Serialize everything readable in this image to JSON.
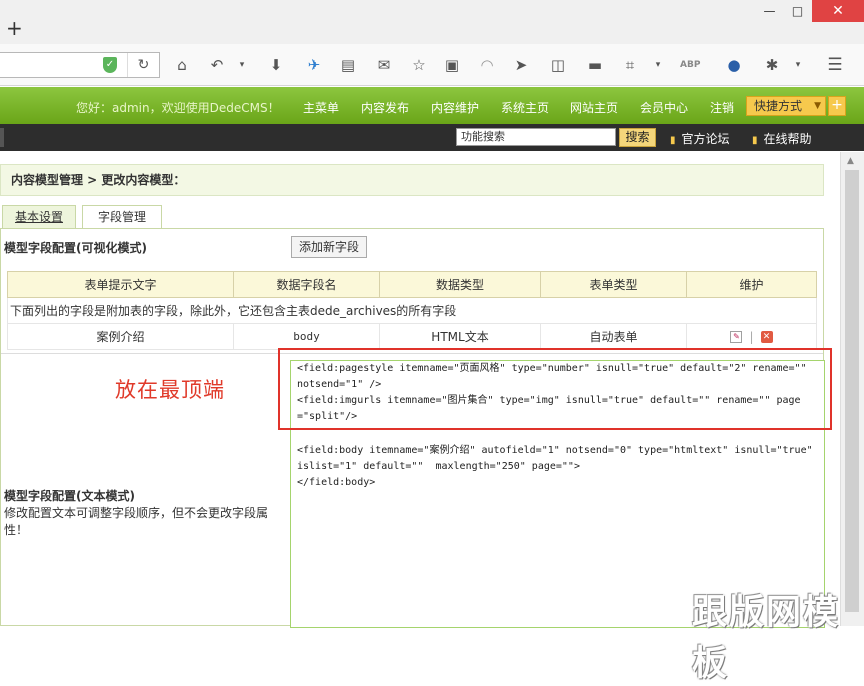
{
  "browser": {
    "new_tab": "+",
    "window_buttons": {
      "minimize": "—",
      "maximize": "□",
      "close": "✕"
    },
    "toolbar_icons": [
      "home-icon",
      "back-icon",
      "dropdown-icon",
      "download-icon",
      "bird-icon",
      "reader-icon",
      "mail-icon",
      "star-icon",
      "clipboard-icon",
      "rss-icon",
      "send-icon",
      "window-icon",
      "folder-icon",
      "crop-icon",
      "dropdown-icon",
      "abp-icon",
      "globe-icon",
      "bug-icon",
      "dropdown-icon",
      "hamburger-icon"
    ]
  },
  "cms_header": {
    "welcome": "您好：admin，欢迎使用DedeCMS！",
    "menu": [
      "主菜单",
      "内容发布",
      "内容维护",
      "系统主页",
      "网站主页",
      "会员中心",
      "注销"
    ],
    "shortcut": "快捷方式",
    "search_value": "功能搜索",
    "search_button": "搜索",
    "links": [
      "官方论坛",
      "在线帮助"
    ]
  },
  "breadcrumb": "内容模型管理 > 更改内容模型：",
  "tabs": [
    "基本设置",
    "字段管理"
  ],
  "visual_mode": {
    "label": "模型字段配置(可视化模式)",
    "add_button": "添加新字段"
  },
  "fields_table": {
    "headers": [
      "表单提示文字",
      "数据字段名",
      "数据类型",
      "表单类型",
      "维护"
    ],
    "note": "下面列出的字段是附加表的字段，除此外，它还包含主表dede_archives的所有字段",
    "rows": [
      {
        "label": "案例介绍",
        "field": "body",
        "datatype": "HTML文本",
        "formtype": "自动表单"
      }
    ]
  },
  "text_mode": {
    "title": "模型字段配置(文本模式)",
    "desc": "修改配置文本可调整字段顺序，但不会更改字段属性！"
  },
  "annotation": "放在最顶端",
  "code_lines": {
    "block1": [
      "<field:pagestyle itemname=\"页面风格\" type=\"number\" isnull=\"true\" default=\"2\" rename=\"\" notsend=\"1\" />",
      "<field:imgurls itemname=\"图片集合\" type=\"img\" isnull=\"true\" default=\"\" rename=\"\" page=\"split\"/>"
    ],
    "block2": [
      "<field:body itemname=\"案例介绍\" autofield=\"1\" notsend=\"0\" type=\"htmltext\" isnull=\"true\" islist=\"1\" default=\"\"  maxlength=\"250\" page=\"\">",
      "</field:body>"
    ]
  },
  "watermark": "跟版网模板",
  "colors": {
    "green": "#7ab628",
    "dark_bar": "#2d2d2d",
    "accent_red": "#e0322a",
    "shortcut_yellow": "#f6c94d"
  }
}
